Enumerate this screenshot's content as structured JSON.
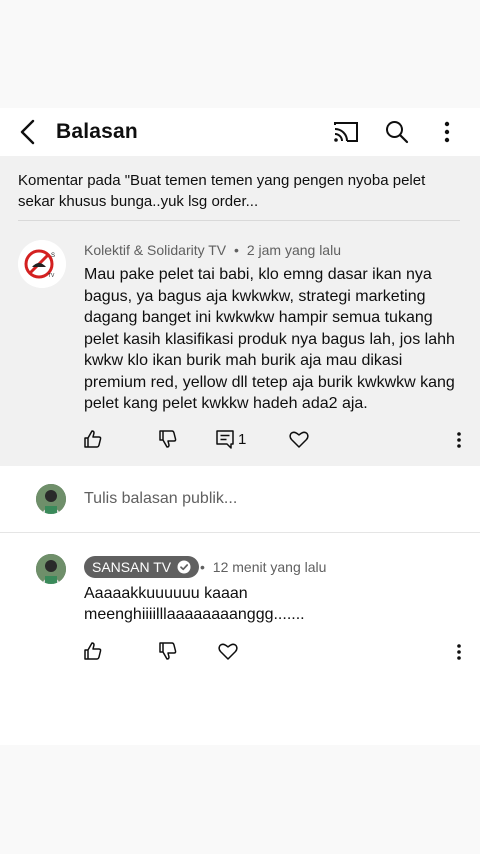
{
  "header": {
    "title": "Balasan",
    "icons": [
      "back-arrow-icon",
      "cast-icon",
      "search-icon",
      "more-vert-icon"
    ]
  },
  "context": {
    "text": "Komentar pada \"Buat temen temen yang pengen nyoba pelet sekar khusus bunga..yuk lsg order..."
  },
  "comment": {
    "author": "Kolektif & Solidarity TV",
    "time": "2 jam yang lalu",
    "body": "Mau pake pelet tai babi, klo emng dasar ikan nya bagus, ya bagus aja kwkwkw, strategi marketing dagang banget ini kwkwkw hampir semua tukang pelet kasih klasifikasi produk nya bagus lah, jos lahh kwkw klo ikan burik mah burik aja mau dikasi premium red, yellow dll tetep aja burik kwkwkw kang pelet kang pelet kwkkw hadeh ada2 aja.",
    "reply_count": "1"
  },
  "composer": {
    "placeholder": "Tulis balasan publik..."
  },
  "reply": {
    "author": "SANSAN TV",
    "time": "12 menit yang lalu",
    "body": "Aaaaakkuuuuuu kaaan meenghiiiilllaaaaaaaanggg......."
  },
  "separator": "•"
}
